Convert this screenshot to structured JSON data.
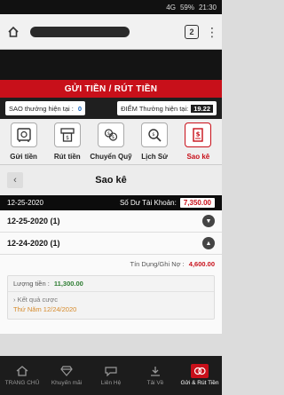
{
  "status_bar": {
    "network": "4G",
    "battery": "59%",
    "time": "21:30"
  },
  "browser": {
    "tab_count": "2"
  },
  "banner": {
    "title": "GỬI TIỀN / RÚT TIỀN"
  },
  "points": {
    "sao_label": "SAO thưởng hiện tại :",
    "sao_value": "0",
    "diem_label": "ĐIỂM Thưởng hiện tại:",
    "diem_value": "19.22"
  },
  "menu": [
    {
      "label": "Gửi tiền",
      "icon": "safe-icon"
    },
    {
      "label": "Rút tiền",
      "icon": "atm-icon"
    },
    {
      "label": "Chuyển Quỹ",
      "icon": "transfer-icon"
    },
    {
      "label": "Lịch Sử",
      "icon": "search-icon"
    },
    {
      "label": "Sao kê",
      "icon": "statement-icon"
    }
  ],
  "page": {
    "title": "Sao kê"
  },
  "balance": {
    "date": "12-25-2020",
    "label": "Số Dư Tài Khoản:",
    "value": "7,350.00"
  },
  "rows": [
    {
      "label": "12-25-2020  (1)"
    },
    {
      "label": "12-24-2020  (1)"
    }
  ],
  "detail": {
    "tin_label": "Tín Dụng/Ghi Nợ :",
    "tin_value": "4,600.00",
    "luong_label": "Lượng tiền :",
    "luong_value": "11,300.00",
    "result_label": "Kết quả cược",
    "date": "Thứ Năm 12/24/2020"
  },
  "bottom_nav": [
    {
      "label": "TRANG CHỦ",
      "icon": "home-icon"
    },
    {
      "label": "Khuyến mãi",
      "icon": "diamond-icon"
    },
    {
      "label": "Liên Hệ",
      "icon": "chat-icon"
    },
    {
      "label": "Tải Về",
      "icon": "download-icon"
    },
    {
      "label": "Gửi & Rút Tiền",
      "icon": "deposit-icon"
    }
  ],
  "colors": {
    "brand_red": "#c8101a",
    "dark": "#141414",
    "green": "#2e7d32"
  }
}
